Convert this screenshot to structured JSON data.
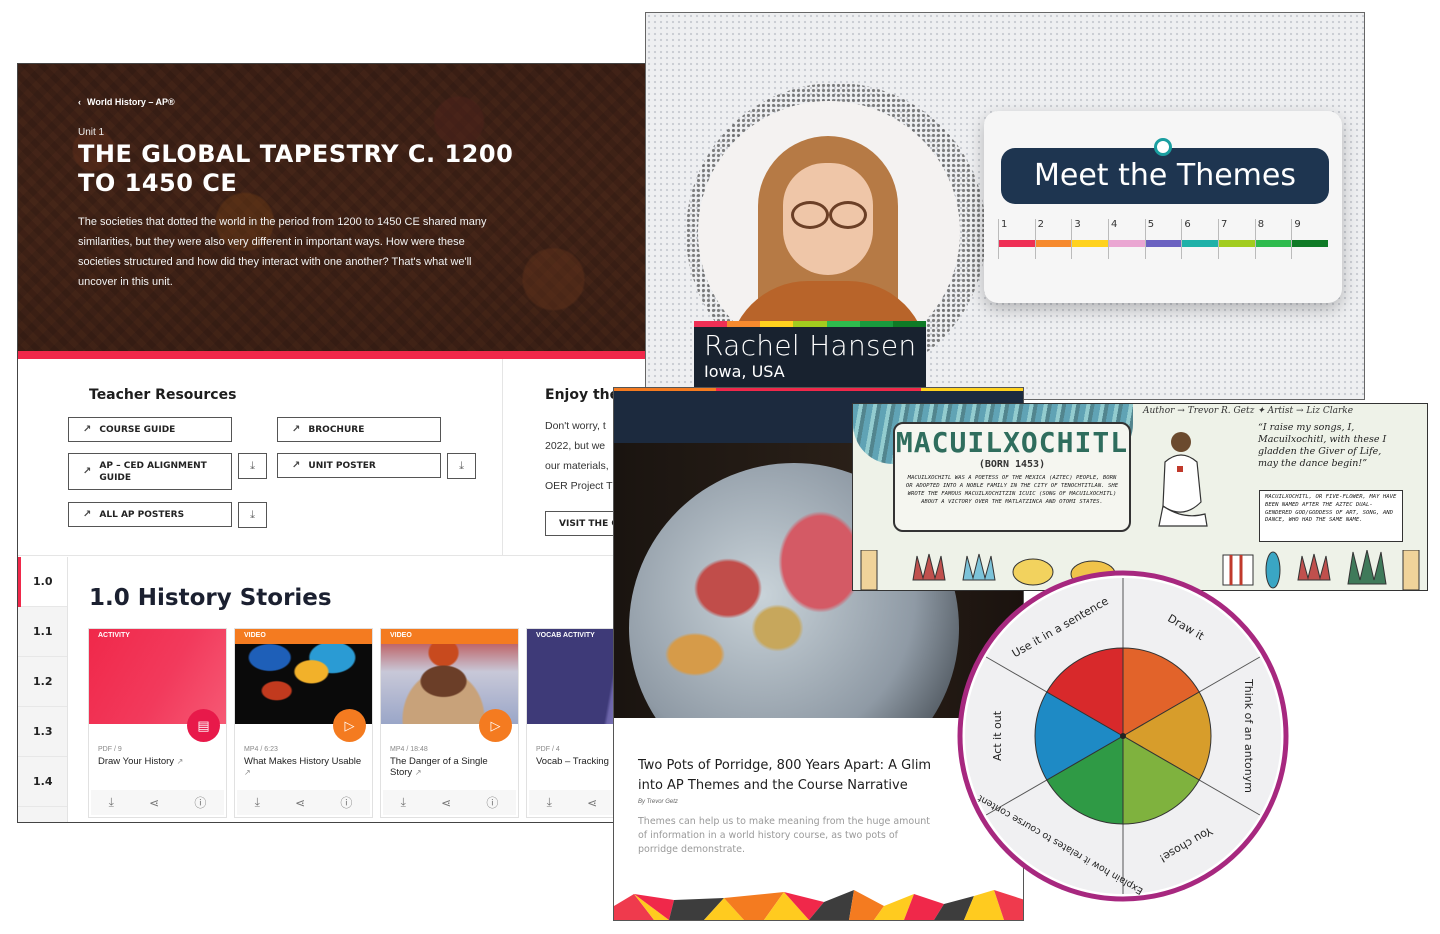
{
  "unit_page": {
    "breadcrumb": "World History – AP®",
    "unit_label": "Unit 1",
    "title_line1": "THE GLOBAL TAPESTRY C. 1200",
    "title_line2": "TO 1450 CE",
    "description": "The societies that dotted the world in the period from 1200 to 1450 CE shared many similarities, but they were also very different in important ways. How were these societies structured and how did they interact with one another? That's what we'll uncover in this unit.",
    "accent_color": "#f0284a",
    "teacher_resources": {
      "title": "Teacher Resources",
      "buttons": [
        {
          "label": "COURSE GUIDE",
          "download": false
        },
        {
          "label": "BROCHURE",
          "download": false
        },
        {
          "label": "AP – CED ALIGNMENT GUIDE",
          "download": true
        },
        {
          "label": "UNIT POSTER",
          "download": true
        },
        {
          "label": "ALL AP POSTERS",
          "download": true
        }
      ],
      "external_icon": "↗",
      "download_icon": "⤓"
    },
    "enjoy": {
      "title": "Enjoy the",
      "text_lines": [
        "Don't worry, t",
        "2022, but we",
        "our materials,",
        "OER Project T"
      ],
      "button": "VISIT THE CO"
    },
    "side_nav": [
      "1.0",
      "1.1",
      "1.2",
      "1.3",
      "1.4"
    ],
    "section_title": "1.0 History Stories",
    "cards": [
      {
        "tag": "ACTIVITY",
        "meta": "PDF / 9",
        "title": "Draw Your History",
        "fab": "document-icon",
        "tag_color": "#f0284a"
      },
      {
        "tag": "VIDEO",
        "meta": "MP4 / 6:23",
        "title": "What Makes History Usable",
        "fab": "play-icon",
        "tag_color": "#f47b20"
      },
      {
        "tag": "VIDEO",
        "meta": "MP4 / 18:48",
        "title": "The Danger of a Single Story",
        "fab": "play-icon",
        "tag_color": "#f47b20"
      },
      {
        "tag": "VOCAB ACTIVITY",
        "meta": "PDF / 4",
        "title": "Vocab – Tracking",
        "fab": null,
        "tag_color": "#3e3a78"
      }
    ]
  },
  "themes_video": {
    "presenter_name": "Rachel Hansen",
    "presenter_location": "Iowa, USA",
    "card_title": "Meet the Themes",
    "themes": [
      {
        "number": "1",
        "color": "#ef2f55"
      },
      {
        "number": "2",
        "color": "#f68a2e"
      },
      {
        "number": "3",
        "color": "#ffd21f"
      },
      {
        "number": "4",
        "color": "#eaa6d2"
      },
      {
        "number": "5",
        "color": "#6b62c1"
      },
      {
        "number": "6",
        "color": "#1fb1a8"
      },
      {
        "number": "7",
        "color": "#a2cc1f"
      },
      {
        "number": "8",
        "color": "#2fbb4e"
      },
      {
        "number": "9",
        "color": "#0f7a26"
      }
    ]
  },
  "article": {
    "title_line1": "Two Pots of Porridge, 800 Years Apart: A Glim",
    "title_line2": "into AP Themes and the Course Narrative",
    "author": "By Trevor Getz",
    "description": "Themes can help us to make meaning from the huge amount of information in a world history course, as two pots of porridge demonstrate."
  },
  "comic": {
    "name": "MACUILXOCHITL",
    "born": "(BORN 1453)",
    "bio": "MACUILXOCHITL WAS A POETESS OF THE MEXICA (AZTEC) PEOPLE, BORN OR ADOPTED INTO A NOBLE FAMILY IN THE CITY OF TENOCHTITLAN. SHE WROTE THE FAMOUS MACUILXOCHITZIN ICUIC (SONG OF MACUILXOCHITL) ABOUT A VICTORY OVER THE MATLATZINCA AND OTOMI STATES.",
    "credit": "Author → Trevor R. Getz  ✦  Artist → Liz Clarke",
    "quote": "“I raise my songs, I, Macuilxochitl, with these I gladden the Giver of Life, may the dance begin!”",
    "note": "MACUILXOCHITL, OR FIVE-FLOWER, MAY HAVE BEEN NAMED AFTER THE AZTEC DUAL-GENDERED GOD/GODDESS OF ART, SONG, AND DANCE, WHO HAD THE SAME NAME."
  },
  "vocab_wheel": {
    "rim_color": "#a7287f",
    "segments": [
      {
        "label": "Draw it",
        "color": "#e2632a"
      },
      {
        "label": "Think of an antonym",
        "color": "#d79d2b"
      },
      {
        "label": "You chose!",
        "color": "#7fb23e"
      },
      {
        "label": "Explain how it relates to course content",
        "color": "#2f9a45"
      },
      {
        "label": "Act it out",
        "color": "#1e8ac5"
      },
      {
        "label": "Use it in a sentence",
        "color": "#d8292b"
      }
    ]
  }
}
